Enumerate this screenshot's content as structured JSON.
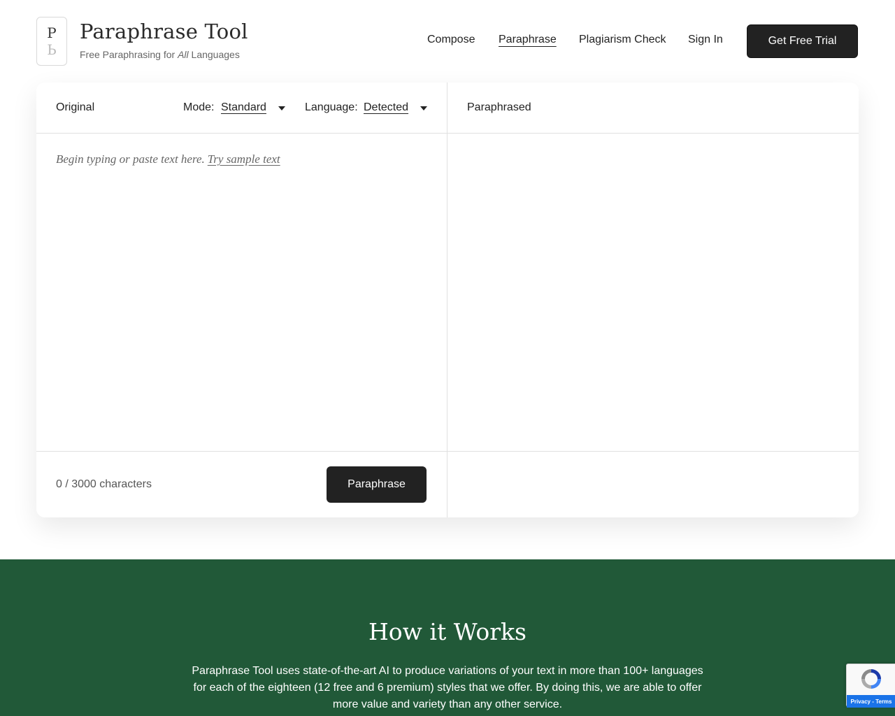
{
  "brand": {
    "logo_top": "P",
    "logo_bottom": "Ь",
    "title": "Paraphrase Tool",
    "subtitle_prefix": "Free Paraphrasing for ",
    "subtitle_emph": "All",
    "subtitle_suffix": " Languages"
  },
  "nav": {
    "compose": "Compose",
    "paraphrase": "Paraphrase",
    "plagiarism": "Plagiarism Check",
    "sign_in": "Sign In",
    "trial": "Get Free Trial"
  },
  "editor": {
    "original_label": "Original",
    "mode_label": "Mode:",
    "mode_value": "Standard",
    "language_label": "Language:",
    "language_value": "Detected",
    "paraphrased_label": "Paraphrased",
    "placeholder": "Begin typing or paste text here.",
    "sample_link": "Try sample text",
    "char_count": "0 / 3000 characters",
    "paraphrase_button": "Paraphrase"
  },
  "how": {
    "title": "How it Works",
    "text": "Paraphrase Tool uses state-of-the-art AI to produce variations of your text in more than 100+ languages for each of the eighteen (12 free and 6 premium) styles that we offer. By doing this, we are able to offer more value and variety than any other service."
  },
  "recaptcha": {
    "footer": "Privacy - Terms"
  },
  "colors": {
    "primary_dark": "#222222",
    "section_green": "#215938",
    "recaptcha_blue": "#1a73e8"
  }
}
